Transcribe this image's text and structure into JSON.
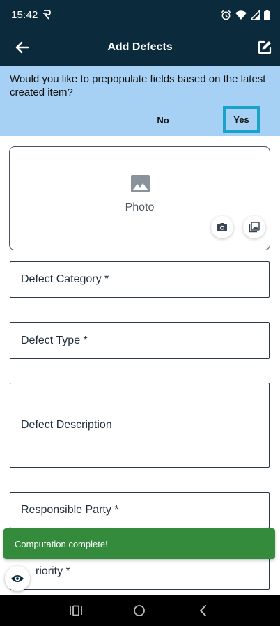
{
  "status_bar": {
    "time": "15:42",
    "icons": [
      "data-saver-icon",
      "alarm-icon",
      "wifi-icon",
      "signal-icon",
      "battery-icon"
    ]
  },
  "app_bar": {
    "title": "Add Defects",
    "back_icon": "arrow-left-icon",
    "edit_icon": "edit-icon"
  },
  "banner": {
    "question": "Would you like to prepopulate fields based on the latest created item?",
    "no_label": "No",
    "yes_label": "Yes"
  },
  "photo": {
    "label": "Photo",
    "camera_icon": "camera-icon",
    "gallery_icon": "gallery-icon"
  },
  "fields": {
    "defect_category": "Defect Category *",
    "defect_type": "Defect Type *",
    "defect_description": "Defect Description",
    "responsible_party": "Responsible Party *",
    "priority": "riority *"
  },
  "toast": {
    "message": "Computation complete!"
  },
  "colors": {
    "app_bar": "#0b2a3c",
    "banner": "#a6d1f4",
    "yes_highlight": "#1aa3c9",
    "toast": "#348b3c"
  }
}
